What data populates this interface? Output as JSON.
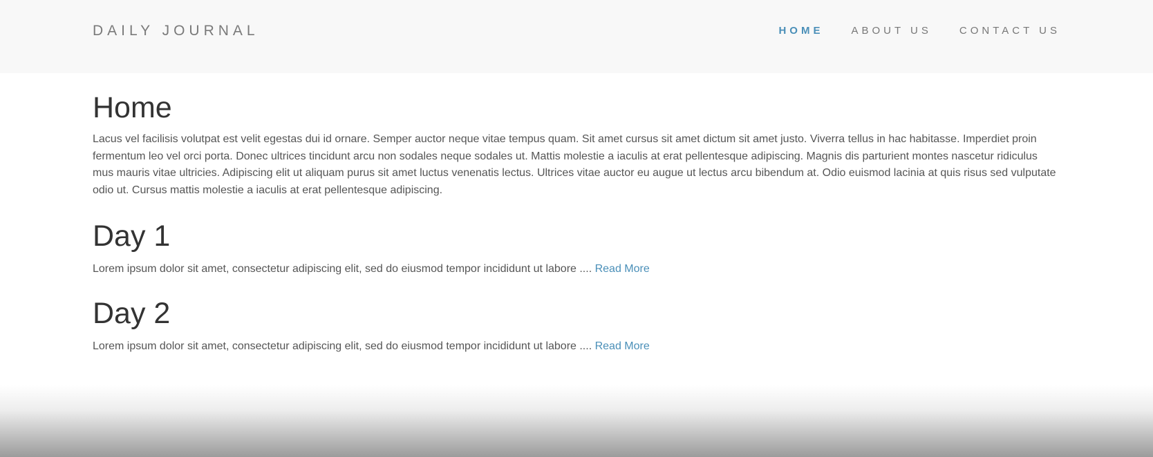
{
  "header": {
    "brand": "DAILY JOURNAL",
    "nav": [
      {
        "label": "HOME",
        "active": true
      },
      {
        "label": "ABOUT US",
        "active": false
      },
      {
        "label": "CONTACT US",
        "active": false
      }
    ]
  },
  "main": {
    "home": {
      "title": "Home",
      "text": "Lacus vel facilisis volutpat est velit egestas dui id ornare. Semper auctor neque vitae tempus quam. Sit amet cursus sit amet dictum sit amet justo. Viverra tellus in hac habitasse. Imperdiet proin fermentum leo vel orci porta. Donec ultrices tincidunt arcu non sodales neque sodales ut. Mattis molestie a iaculis at erat pellentesque adipiscing. Magnis dis parturient montes nascetur ridiculus mus mauris vitae ultricies. Adipiscing elit ut aliquam purus sit amet luctus venenatis lectus. Ultrices vitae auctor eu augue ut lectus arcu bibendum at. Odio euismod lacinia at quis risus sed vulputate odio ut. Cursus mattis molestie a iaculis at erat pellentesque adipiscing."
    },
    "posts": [
      {
        "title": "Day 1",
        "excerpt": "Lorem ipsum dolor sit amet, consectetur adipiscing elit, sed do eiusmod tempor incididunt ut labore .... ",
        "read_more": "Read More"
      },
      {
        "title": "Day 2",
        "excerpt": "Lorem ipsum dolor sit amet, consectetur adipiscing elit, sed do eiusmod tempor incididunt ut labore .... ",
        "read_more": "Read More"
      }
    ]
  },
  "colors": {
    "accent": "#4a8fb8",
    "navbar_bg": "#f8f8f8",
    "text": "#555555",
    "heading": "#333333"
  }
}
